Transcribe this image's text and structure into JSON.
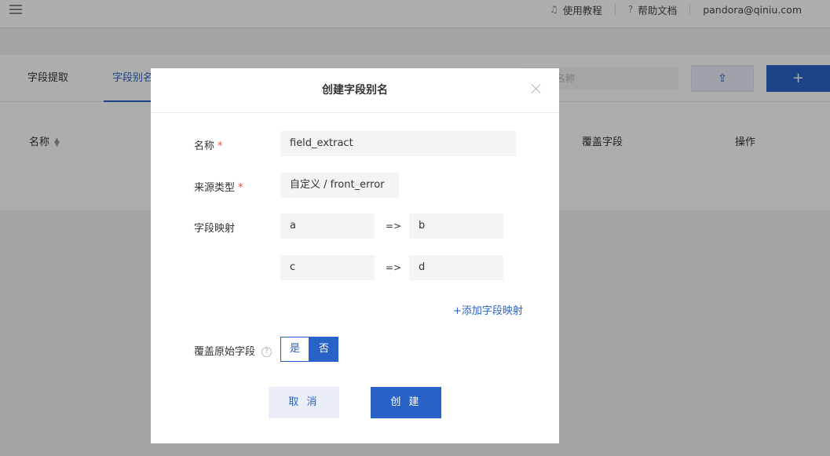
{
  "topbar": {
    "tutorial": "使用教程",
    "help_docs": "帮助文档",
    "user": "pandora@qiniu.com"
  },
  "tabs": [
    {
      "label": "字段提取",
      "active": false
    },
    {
      "label": "字段别名",
      "active": true
    }
  ],
  "search": {
    "placeholder": "索规则名称"
  },
  "toolbar": {
    "upload_icon": "upload-icon",
    "add_label": "+"
  },
  "table": {
    "headers": {
      "name": "名称",
      "cover": "覆盖字段",
      "actions": "操作"
    }
  },
  "modal": {
    "title": "创建字段别名",
    "name_label": "名称",
    "name_value": "field_extract",
    "source_label": "来源类型",
    "source_value": "自定义 / front_error",
    "mapping_label": "字段映射",
    "mappings": [
      {
        "from": "a",
        "arrow": "=>",
        "to": "b"
      },
      {
        "from": "c",
        "arrow": "=>",
        "to": "d"
      }
    ],
    "add_mapping": "+添加字段映射",
    "cover_label": "覆盖原始字段",
    "cover_options": {
      "yes": "是",
      "no": "否",
      "selected": "否"
    },
    "cancel": "取 消",
    "create": "创 建"
  },
  "colors": {
    "accent": "#2a63c7",
    "required": "#e24d4d"
  }
}
